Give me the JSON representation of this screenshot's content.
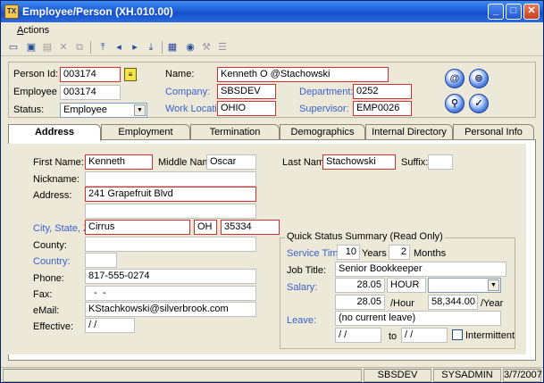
{
  "window": {
    "app_icon_text": "TX",
    "title": "Employee/Person  (XH.010.00)",
    "min_glyph": "_",
    "max_glyph": "□",
    "close_glyph": "✕"
  },
  "menu": {
    "actions_label": "ctions",
    "actions_mnemonic": "A"
  },
  "toolbar": {
    "icons": [
      "new-icon",
      "save-icon",
      "print-icon",
      "delete-icon",
      "copy-icon",
      "first-icon",
      "prev-icon",
      "next-icon",
      "last-icon",
      "calculator-icon",
      "help-icon",
      "tools-icon",
      "list-icon"
    ]
  },
  "header": {
    "person_id_label": "Person Id:",
    "person_id_value": "003174",
    "employee_id_label": "Employee Id:",
    "employee_id_value": "003174",
    "status_label": "Status:",
    "status_value": "Employee",
    "name_label": "Name:",
    "name_value": "Kenneth O @Stachowski",
    "company_label": "Company:",
    "company_value": "SBSDEV",
    "department_label": "Department:",
    "department_value": "0252",
    "work_location_label": "Work Location:",
    "work_location_value": "OHIO",
    "supervisor_label": "Supervisor:",
    "supervisor_value": "EMP0026"
  },
  "tabs": [
    {
      "label": "Address",
      "active": true
    },
    {
      "label": "Employment",
      "active": false
    },
    {
      "label": "Termination",
      "active": false
    },
    {
      "label": "Demographics",
      "active": false
    },
    {
      "label": "Internal Directory",
      "active": false
    },
    {
      "label": "Personal Info",
      "active": false
    }
  ],
  "address": {
    "first_name_label": "First Name:",
    "first_name_value": "Kenneth",
    "middle_name_label": "Middle Name:",
    "middle_name_value": "Oscar",
    "last_name_label": "Last Name:",
    "last_name_value": "Stachowski",
    "suffix_label": "Suffix:",
    "suffix_value": "",
    "nickname_label": "Nickname:",
    "nickname_value": "",
    "address_label": "Address:",
    "address_line1": "241 Grapefruit Blvd",
    "address_line2": "",
    "city_state_zip_label": "City, State, Zip:",
    "city_value": "Cirrus",
    "state_value": "OH",
    "zip_value": "35334",
    "county_label": "County:",
    "county_value": "",
    "country_label": "Country:",
    "country_value": "",
    "phone_label": "Phone:",
    "phone_value": "817-555-0274",
    "fax_label": "Fax:",
    "fax_value": "  -  -",
    "email_label": "eMail:",
    "email_value": "KStachkowski@silverbrook.com",
    "effective_label": "Effective:",
    "effective_value": "/ /"
  },
  "quick_status": {
    "title": "Quick Status Summary (Read Only)",
    "service_time_label": "Service Time:",
    "years_value": "10",
    "years_label": "Years",
    "months_value": "2",
    "months_label": "Months",
    "job_title_label": "Job Title:",
    "job_title_value": "Senior Bookkeeper",
    "salary_label": "Salary:",
    "salary_rate": "28.05",
    "salary_unit": "HOUR",
    "salary_extra": "",
    "hourly_value": "28.05",
    "hourly_label": "/Hour",
    "yearly_value": "58,344.00",
    "yearly_label": "/Year",
    "leave_label": "Leave:",
    "leave_value": "(no current leave)",
    "leave_from": "/ /",
    "to_label": "to",
    "leave_to": "/ /",
    "intermittent_label": "Intermittent"
  },
  "statusbar": {
    "company": "SBSDEV",
    "user": "SYSADMIN",
    "date": "3/7/2007"
  }
}
